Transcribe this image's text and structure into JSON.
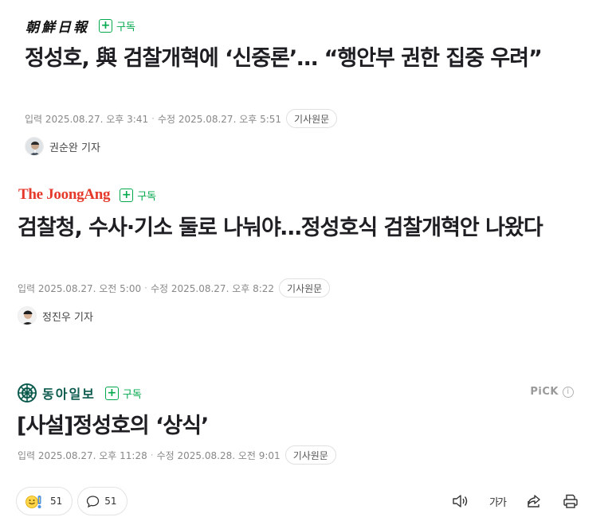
{
  "articles": [
    {
      "press": "朝鮮日報",
      "subscribe_label": "구독",
      "headline": "정성호, 與 검찰개혁에 ‘신중론’… “행안부 권한 집중 우려”",
      "input_label": "입력",
      "input_time": "2025.08.27. 오후 3:41",
      "edit_label": "수정",
      "edit_time": "2025.08.27. 오후 5:51",
      "origin_label": "기사원문",
      "reporter": "권순완 기자"
    },
    {
      "press": "The JoongAng",
      "subscribe_label": "구독",
      "headline": "검찰청, 수사·기소 둘로 나눠야…정성호식 검찰개혁안 나왔다",
      "input_label": "입력",
      "input_time": "2025.08.27. 오전 5:00",
      "edit_label": "수정",
      "edit_time": "2025.08.27. 오후 8:22",
      "origin_label": "기사원문",
      "reporter": "정진우 기자"
    },
    {
      "press": "동아일보",
      "subscribe_label": "구독",
      "headline": "[사설]정성호의 ‘상식’",
      "input_label": "입력",
      "input_time": "2025.08.27. 오후 11:28",
      "edit_label": "수정",
      "edit_time": "2025.08.28. 오전 9:01",
      "origin_label": "기사원문",
      "pick_label": "PiCK",
      "pick_info": "i"
    }
  ],
  "bottom_bar": {
    "reaction_count": "51",
    "comment_count": "51",
    "font_size_label": "가가"
  },
  "colors": {
    "accent_green": "#03a94d",
    "joongang_red": "#e5392b",
    "donga_green": "#0b5a4d"
  }
}
